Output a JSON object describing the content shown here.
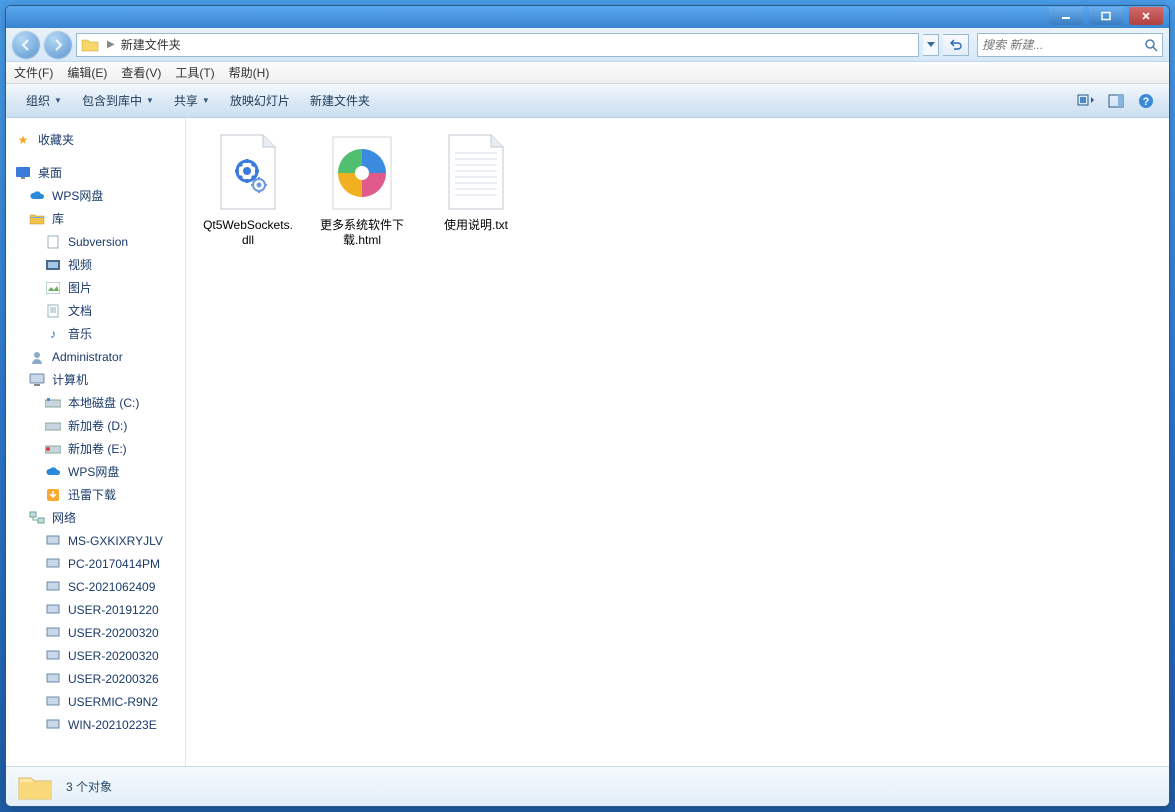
{
  "address": {
    "folder": "新建文件夹"
  },
  "search": {
    "placeholder": "搜索 新建..."
  },
  "menubar": [
    "文件(F)",
    "编辑(E)",
    "查看(V)",
    "工具(T)",
    "帮助(H)"
  ],
  "toolbar": {
    "organize": "组织",
    "include": "包含到库中",
    "share": "共享",
    "slideshow": "放映幻灯片",
    "newfolder": "新建文件夹"
  },
  "sidebar": {
    "favorites": "收藏夹",
    "desktop": "桌面",
    "wps": "WPS网盘",
    "library": "库",
    "lib_items": [
      "Subversion",
      "视频",
      "图片",
      "文档",
      "音乐"
    ],
    "admin": "Administrator",
    "computer": "计算机",
    "drives": [
      "本地磁盘 (C:)",
      "新加卷 (D:)",
      "新加卷 (E:)",
      "WPS网盘",
      "迅雷下载"
    ],
    "network": "网络",
    "net_items": [
      "MS-GXKIXRYJLV",
      "PC-20170414PM",
      "SC-2021062409",
      "USER-20191220",
      "USER-20200320",
      "USER-20200320",
      "USER-20200326",
      "USERMIC-R9N2",
      "WIN-20210223E"
    ]
  },
  "files": [
    {
      "name": "Qt5WebSockets.dll",
      "type": "dll"
    },
    {
      "name": "更多系统软件下载.html",
      "type": "html"
    },
    {
      "name": "使用说明.txt",
      "type": "txt"
    }
  ],
  "status": {
    "count": "3 个对象"
  }
}
